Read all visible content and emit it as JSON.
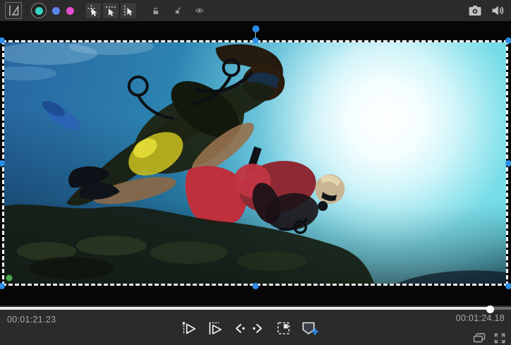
{
  "toolbar": {
    "mask_colors": {
      "teal": "#38d2c6",
      "blue": "#5b86e8",
      "magenta": "#e14fcf"
    },
    "selected_color": "teal",
    "left_icons": [
      "flip-tool",
      "mask-color-teal",
      "mask-color-blue",
      "mask-color-magenta",
      "mask-crosshair-tool",
      "mask-line-select-tool",
      "mask-point-select-tool",
      "unlock",
      "erase-brush",
      "visibility-eye"
    ],
    "right_icons": [
      "snapshot-camera",
      "speaker-volume"
    ]
  },
  "player": {
    "current_time": "00:01:21.23",
    "end_time": "00:01:24.18",
    "progress_fill_width": "95.8%",
    "seek_handle_left": "calc(95.8% - 5px)",
    "controls": [
      "play-from-in-point",
      "play-to-out-point",
      "previous-frame",
      "next-frame",
      "fit-frame",
      "add-marker"
    ],
    "corner_icons": [
      "picture-in-picture",
      "fullscreen"
    ]
  },
  "selection": {
    "handle_color": "#2d8de6",
    "border": "white-dashed",
    "handles": [
      "top-left",
      "top-center",
      "top-right",
      "middle-left",
      "middle-right",
      "bottom-left",
      "bottom-center",
      "bottom-right",
      "rotation"
    ]
  },
  "colors": {
    "toolbar_bg": "#2b2b2b",
    "preview_bg": "#060606",
    "timecode_text": "#a9a9a9",
    "accent_blue": "#2d8de6"
  }
}
